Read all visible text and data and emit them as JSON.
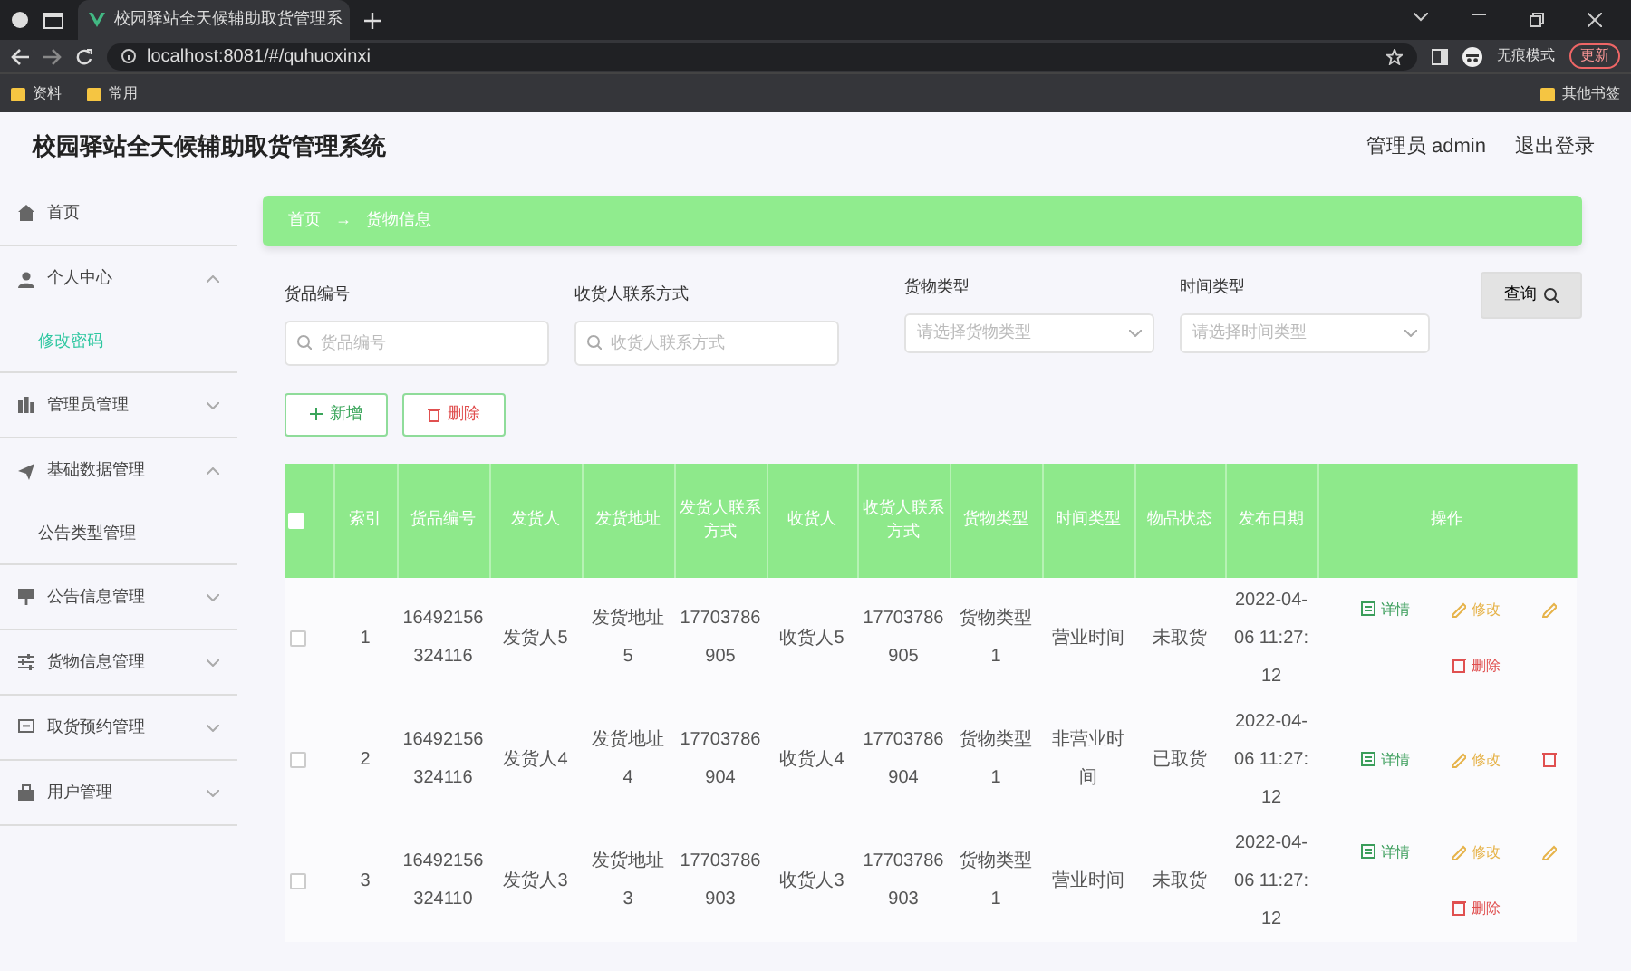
{
  "browser": {
    "tab_title": "校园驿站全天候辅助取货管理系",
    "url": "localhost:8081/#/quhuoxinxi",
    "profile": "无痕模式",
    "update_button": "更新",
    "bookmarks": [
      "资料",
      "常用"
    ],
    "other_bookmarks": "其他书签"
  },
  "app": {
    "title": "校园驿站全天候辅助取货管理系统",
    "user": "管理员 admin",
    "logout": "退出登录"
  },
  "sidebar": {
    "items": [
      {
        "label": "首页",
        "selected": false
      },
      {
        "label": "个人中心",
        "selected": false,
        "expanded": true,
        "children": [
          {
            "label": "修改密码",
            "selected": true
          }
        ]
      },
      {
        "label": "管理员管理",
        "selected": false,
        "expanded": false
      },
      {
        "label": "基础数据管理",
        "selected": false,
        "expanded": true,
        "children": [
          {
            "label": "公告类型管理",
            "selected": false
          }
        ]
      },
      {
        "label": "公告信息管理",
        "selected": false,
        "expanded": false
      },
      {
        "label": "货物信息管理",
        "selected": false,
        "expanded": false
      },
      {
        "label": "取货预约管理",
        "selected": false,
        "expanded": false
      },
      {
        "label": "用户管理",
        "selected": false,
        "expanded": false
      }
    ]
  },
  "breadcrumb": {
    "items": [
      "首页",
      "货物信息"
    ],
    "separator": "→"
  },
  "filters": [
    {
      "label": "货品编号",
      "kind": "text",
      "placeholder": "货品编号"
    },
    {
      "label": "收货人联系方式",
      "kind": "text",
      "placeholder": "收货人联系方式"
    },
    {
      "label": "货物类型",
      "kind": "select",
      "placeholder": "请选择货物类型"
    },
    {
      "label": "时间类型",
      "kind": "select",
      "placeholder": "请选择时间类型"
    }
  ],
  "search_button": "查询",
  "actions": [
    {
      "kind": "add",
      "label": "新增"
    },
    {
      "kind": "delete",
      "label": "删除"
    }
  ],
  "table": {
    "select_all": {
      "checked": false
    },
    "columns": [
      "索引",
      "货品编号",
      "发货人",
      "发货地址",
      "发货人联系方式",
      "收货人",
      "收货人联系方式",
      "货物类型",
      "时间类型",
      "物品状态",
      "发布日期",
      "操作"
    ],
    "rows": [
      {
        "checked": false,
        "cells": [
          "1",
          "16492156324116",
          "发货人5",
          "发货地址5",
          "17703786905",
          "收货人5",
          "17703786905",
          "货物类型1",
          "营业时间",
          "未取货",
          "2022-04-06 11:27:12"
        ],
        "operations": [
          {
            "kind": "detail",
            "label": "详情"
          },
          {
            "kind": "edit",
            "label": "修改"
          },
          {
            "kind": "edit"
          },
          {
            "kind": "delete",
            "label": "删除"
          }
        ]
      },
      {
        "checked": false,
        "cells": [
          "2",
          "16492156324116",
          "发货人4",
          "发货地址4",
          "17703786904",
          "收货人4",
          "17703786904",
          "货物类型1",
          "非营业时间",
          "已取货",
          "2022-04-06 11:27:12"
        ],
        "operations": [
          {
            "kind": "detail",
            "label": "详情"
          },
          {
            "kind": "edit",
            "label": "修改"
          },
          {
            "kind": "delete"
          }
        ]
      },
      {
        "checked": false,
        "cells": [
          "3",
          "16492156324110",
          "发货人3",
          "发货地址3",
          "17703786903",
          "收货人3",
          "17703786903",
          "货物类型1",
          "营业时间",
          "未取货",
          "2022-04-06 11:27:12"
        ],
        "operations": [
          {
            "kind": "detail",
            "label": "详情"
          },
          {
            "kind": "edit",
            "label": "修改"
          },
          {
            "kind": "edit"
          },
          {
            "kind": "delete",
            "label": "删除"
          }
        ]
      }
    ]
  }
}
